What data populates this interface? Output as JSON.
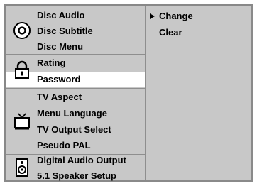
{
  "menu": {
    "groups": [
      {
        "icon": "disc-icon",
        "items": [
          "Disc Audio",
          "Disc Subtitle",
          "Disc Menu"
        ]
      },
      {
        "icon": "lock-icon",
        "items": [
          "Rating",
          "Password"
        ],
        "selected_index": 1
      },
      {
        "icon": "tv-icon",
        "items": [
          "TV Aspect",
          "Menu Language",
          "TV Output Select",
          "Pseudo PAL"
        ]
      },
      {
        "icon": "speaker-icon",
        "items": [
          "Digital Audio Output",
          "5.1 Speaker Setup"
        ]
      }
    ]
  },
  "submenu": {
    "items": [
      "Change",
      "Clear"
    ],
    "active_index": 0
  },
  "colors": {
    "panel": "#c8c8c8",
    "highlight": "#ffffff",
    "divider": "#8e8e8e",
    "text": "#000000"
  }
}
